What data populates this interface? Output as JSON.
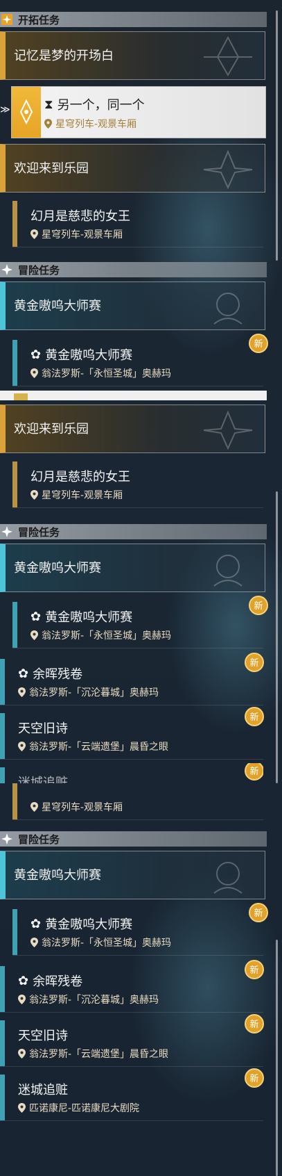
{
  "sections": {
    "trailblaze": "开拓任务",
    "adventure": "冒险任务"
  },
  "quests": {
    "memory": "记忆是梦的开场白",
    "another": "另一个，同一个",
    "another_loc": "星穹列车-观景车厢",
    "welcome": "欢迎来到乐园",
    "moon": "幻月是慈悲的女王",
    "moon_loc": "星穹列车-观景车厢",
    "gold": "黄金嗷呜大师赛",
    "gold_sub": "黄金嗷呜大师赛",
    "gold_loc": "翁法罗斯-「永恒圣城」奥赫玛",
    "embers": "余晖残卷",
    "embers_loc": "翁法罗斯-「沉沦暮城」奥赫玛",
    "sky": "天空旧诗",
    "sky_loc": "翁法罗斯-「云端遗堡」晨昏之眼",
    "maze": "迷城追赃",
    "maze_partial": "迷城追赃",
    "maze_loc": "匹诺康尼-匹诺康尼大剧院"
  },
  "badge": "新",
  "colors": {
    "gold": "#d9a23c",
    "blue": "#4fc3d8",
    "badge": "#e0a22a"
  }
}
